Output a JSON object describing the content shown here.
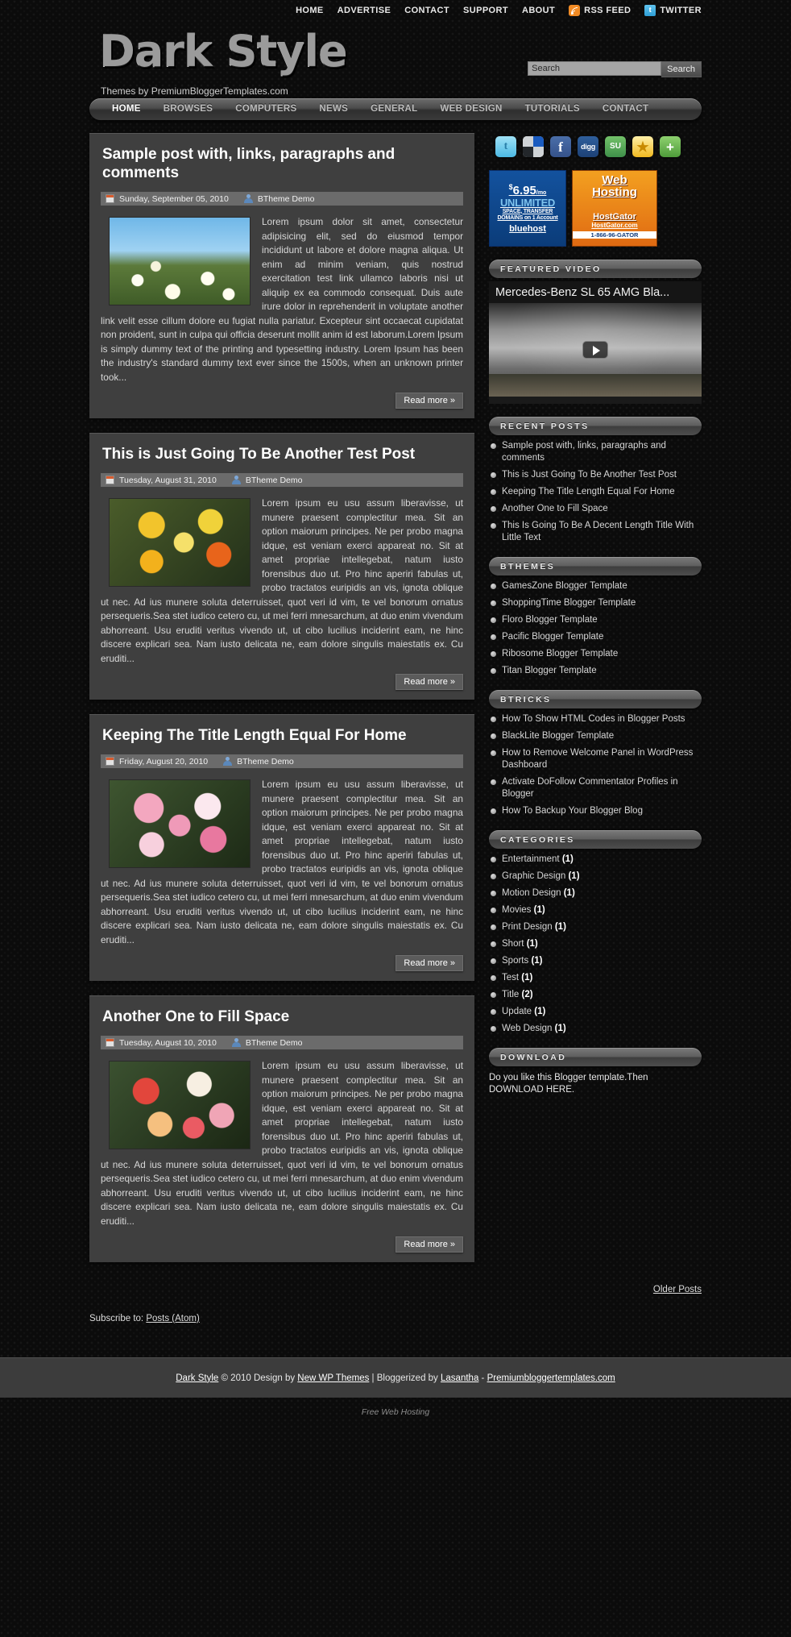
{
  "topnav": {
    "items": [
      {
        "label": "HOME",
        "icon": null
      },
      {
        "label": "ADVERTISE",
        "icon": null
      },
      {
        "label": "CONTACT",
        "icon": null
      },
      {
        "label": "SUPPORT",
        "icon": null
      },
      {
        "label": "ABOUT",
        "icon": null
      },
      {
        "label": "RSS FEED",
        "icon": "rss-icon"
      },
      {
        "label": "TWITTER",
        "icon": "twitter-icon"
      }
    ]
  },
  "header": {
    "logo": "Dark Style",
    "tagline": "Themes by PremiumBloggerTemplates.com",
    "search": {
      "value": "",
      "placeholder": "Search",
      "button_label": "Search"
    }
  },
  "menu": {
    "items": [
      "HOME",
      "BROWSES",
      "COMPUTERS",
      "NEWS",
      "GENERAL",
      "WEB DESIGN",
      "TUTORIALS",
      "CONTACT"
    ],
    "active": "HOME"
  },
  "posts": [
    {
      "title": "Sample post with, links, paragraphs and comments",
      "date": "Sunday, September 05, 2010",
      "author": "BTheme Demo",
      "body": "Lorem ipsum dolor sit amet, consectetur adipisicing elit, sed do eiusmod tempor incididunt ut labore et dolore magna aliqua. Ut enim ad minim veniam, quis nostrud exercitation test link ullamco laboris nisi ut aliquip ex ea commodo consequat. Duis aute irure dolor in reprehenderit in voluptate another link velit esse cillum dolore eu fugiat nulla pariatur. Excepteur sint occaecat cupidatat non proident, sunt in culpa qui officia deserunt mollit anim id est laborum.Lorem Ipsum is simply dummy text of the printing and typesetting industry. Lorem Ipsum has been the industry's standard dummy text ever since the 1500s, when an unknown printer took...",
      "readmore": "Read more »",
      "image": "img-daisies"
    },
    {
      "title": "This is Just Going To Be Another Test Post",
      "date": "Tuesday, August 31, 2010",
      "author": "BTheme Demo",
      "body": "Lorem ipsum eu usu assum liberavisse, ut munere praesent complectitur mea. Sit an option maiorum principes. Ne per probo magna idque, est veniam exerci appareat no. Sit at amet propriae intellegebat, natum iusto forensibus duo ut. Pro hinc aperiri fabulas ut, probo tractatos euripidis an vis, ignota oblique ut nec. Ad ius munere soluta deterruisset, quot veri id vim, te vel bonorum ornatus persequeris.Sea stet iudico cetero cu, ut mei ferri mnesarchum, at duo enim vivendum abhorreant. Usu eruditi veritus vivendo ut, ut cibo lucilius inciderint eam, ne hinc discere explicari sea. Nam iusto delicata ne, eam dolore singulis maiestatis ex. Cu eruditi...",
      "readmore": "Read more »",
      "image": "img-lilies"
    },
    {
      "title": "Keeping The Title Length Equal For Home",
      "date": "Friday, August 20, 2010",
      "author": "BTheme Demo",
      "body": "Lorem ipsum eu usu assum liberavisse, ut munere praesent complectitur mea. Sit an option maiorum principes. Ne per probo magna idque, est veniam exerci appareat no. Sit at amet propriae intellegebat, natum iusto forensibus duo ut. Pro hinc aperiri fabulas ut, probo tractatos euripidis an vis, ignota oblique ut nec. Ad ius munere soluta deterruisset, quot veri id vim, te vel bonorum ornatus persequeris.Sea stet iudico cetero cu, ut mei ferri mnesarchum, at duo enim vivendum abhorreant. Usu eruditi veritus vivendo ut, ut cibo lucilius inciderint eam, ne hinc discere explicari sea. Nam iusto delicata ne, eam dolore singulis maiestatis ex. Cu eruditi...",
      "readmore": "Read more »",
      "image": "img-roses"
    },
    {
      "title": "Another One to Fill Space",
      "date": "Tuesday, August 10, 2010",
      "author": "BTheme Demo",
      "body": "Lorem ipsum eu usu assum liberavisse, ut munere praesent complectitur mea. Sit an option maiorum principes. Ne per probo magna idque, est veniam exerci appareat no. Sit at amet propriae intellegebat, natum iusto forensibus duo ut. Pro hinc aperiri fabulas ut, probo tractatos euripidis an vis, ignota oblique ut nec. Ad ius munere soluta deterruisset, quot veri id vim, te vel bonorum ornatus persequeris.Sea stet iudico cetero cu, ut mei ferri mnesarchum, at duo enim vivendum abhorreant. Usu eruditi veritus vivendo ut, ut cibo lucilius inciderint eam, ne hinc discere explicari sea. Nam iusto delicata ne, eam dolore singulis maiestatis ex. Cu eruditi...",
      "readmore": "Read more »",
      "image": "img-mixroses"
    }
  ],
  "sidebar": {
    "social": [
      {
        "name": "twitter-icon",
        "glyph": "t"
      },
      {
        "name": "delicious-icon",
        "glyph": ""
      },
      {
        "name": "facebook-icon",
        "glyph": "f"
      },
      {
        "name": "digg-icon",
        "glyph": "digg"
      },
      {
        "name": "stumbleupon-icon",
        "glyph": "SU"
      },
      {
        "name": "favorites-star-icon",
        "glyph": "★"
      },
      {
        "name": "share-more-icon",
        "glyph": "+"
      }
    ],
    "ads": {
      "bluehost": {
        "price": "6.95",
        "currency": "$",
        "per": "/mo",
        "headline": "UNLIMITED",
        "line1": "SPACE, TRANSFER",
        "line2": "DOMAINS on 1 Account",
        "brand": "bluehost"
      },
      "hostgator": {
        "word1": "Web",
        "word2": "Hosting",
        "word3": "HostGator",
        "word4": "HostGator.com",
        "word5": "1-866-96-GATOR"
      }
    },
    "featured_video": {
      "heading": "FEATURED VIDEO",
      "title": "Mercedes-Benz SL 65 AMG Bla..."
    },
    "recent_posts": {
      "heading": "RECENT POSTS",
      "items": [
        "Sample post with, links, paragraphs and comments",
        "This is Just Going To Be Another Test Post",
        "Keeping The Title Length Equal For Home",
        "Another One to Fill Space",
        "This Is Going To Be A Decent Length Title With Little Text"
      ]
    },
    "bthemes": {
      "heading": "BTHEMES",
      "items": [
        "GamesZone Blogger Template",
        "ShoppingTime Blogger Template",
        "Floro Blogger Template",
        "Pacific Blogger Template",
        "Ribosome Blogger Template",
        "Titan Blogger Template"
      ]
    },
    "btricks": {
      "heading": "BTRICKS",
      "items": [
        "How To Show HTML Codes in Blogger Posts",
        "BlackLite Blogger Template",
        "How to Remove Welcome Panel in WordPress Dashboard",
        "Activate DoFollow Commentator Profiles in Blogger",
        "How To Backup Your Blogger Blog"
      ]
    },
    "categories": {
      "heading": "CATEGORIES",
      "items": [
        {
          "label": "Entertainment",
          "count": "(1)"
        },
        {
          "label": "Graphic Design",
          "count": "(1)"
        },
        {
          "label": "Motion Design",
          "count": "(1)"
        },
        {
          "label": "Movies",
          "count": "(1)"
        },
        {
          "label": "Print Design",
          "count": "(1)"
        },
        {
          "label": "Short",
          "count": "(1)"
        },
        {
          "label": "Sports",
          "count": "(1)"
        },
        {
          "label": "Test",
          "count": "(1)"
        },
        {
          "label": "Title",
          "count": "(2)"
        },
        {
          "label": "Update",
          "count": "(1)"
        },
        {
          "label": "Web Design",
          "count": "(1)"
        }
      ]
    },
    "download": {
      "heading": "DOWNLOAD",
      "text": "Do you like this Blogger template.Then DOWNLOAD HERE."
    }
  },
  "pagination": {
    "older_posts": "Older Posts"
  },
  "subscribe": {
    "label": "Subscribe to:",
    "link": "Posts (Atom)"
  },
  "footer": {
    "site": "Dark Style",
    "copy": "© 2010 Design by",
    "designer": "New WP Themes",
    "mid": "| Bloggerized by",
    "author": "Lasantha",
    "dash": "-",
    "site2": "Premiumbloggertemplates.com",
    "credit": "Free Web Hosting"
  }
}
